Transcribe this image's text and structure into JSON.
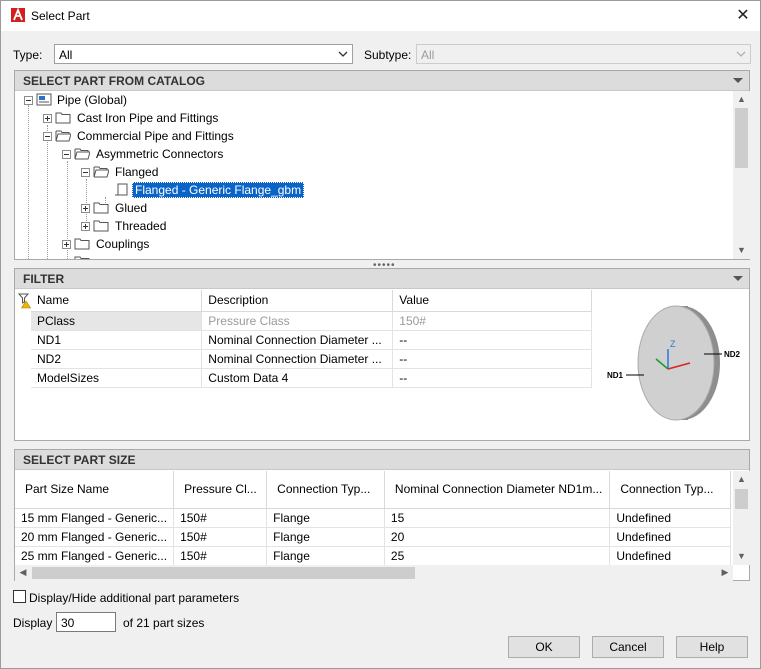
{
  "window": {
    "title": "Select Part",
    "close_glyph": "✕"
  },
  "type_field": {
    "label": "Type:",
    "value": "All"
  },
  "subtype_field": {
    "label": "Subtype:",
    "value": "All"
  },
  "catalog": {
    "header": "SELECT PART FROM CATALOG",
    "tree": [
      {
        "label": "Pipe (Global)"
      },
      {
        "label": "Cast Iron Pipe and Fittings"
      },
      {
        "label": "Commercial Pipe and Fittings"
      },
      {
        "label": "Asymmetric Connectors"
      },
      {
        "label": "Flanged"
      },
      {
        "label": "Flanged - Generic Flange_gbm"
      },
      {
        "label": "Glued"
      },
      {
        "label": "Threaded"
      },
      {
        "label": "Couplings"
      }
    ]
  },
  "splitter": {
    "grip": "•••••"
  },
  "filter": {
    "header": "FILTER",
    "columns": [
      "Name",
      "Description",
      "Value"
    ],
    "rows": [
      {
        "name": "PClass",
        "description": "Pressure Class",
        "value": "150#"
      },
      {
        "name": "ND1",
        "description": "Nominal Connection Diameter ...",
        "value": "--"
      },
      {
        "name": "ND2",
        "description": "Nominal Connection Diameter ...",
        "value": "--"
      },
      {
        "name": "ModelSizes",
        "description": "Custom Data 4",
        "value": "--"
      }
    ],
    "preview": {
      "label_left": "ND1",
      "label_right": "ND2",
      "axis_z": "Z"
    }
  },
  "part_size": {
    "header": "SELECT PART SIZE",
    "columns": [
      "Part Size Name",
      "Pressure Cl...",
      "Connection Typ...",
      "Nominal Connection Diameter ND1m...",
      "Connection Typ..."
    ],
    "rows": [
      [
        "15 mm Flanged - Generic...",
        "150#",
        "Flange",
        "15",
        "Undefined"
      ],
      [
        "20 mm Flanged - Generic...",
        "150#",
        "Flange",
        "20",
        "Undefined"
      ],
      [
        "25 mm Flanged - Generic...",
        "150#",
        "Flange",
        "25",
        "Undefined"
      ]
    ]
  },
  "options": {
    "display_hide_label": "Display/Hide additional part parameters",
    "display_label": "Display",
    "display_value": "30",
    "count_text": "of 21 part sizes"
  },
  "buttons": {
    "ok": "OK",
    "cancel": "Cancel",
    "help": "Help"
  },
  "colors": {
    "selection": "#0a64c8",
    "header_bg": "#dcdcdc",
    "accent_red": "#d21f1f"
  }
}
